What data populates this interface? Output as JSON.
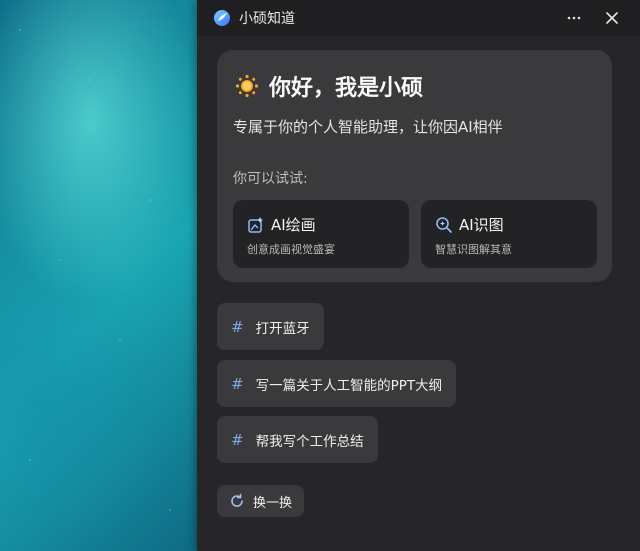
{
  "window": {
    "title": "小硕知道",
    "more_icon": "more-horizontal-icon",
    "close_icon": "close-icon"
  },
  "welcome": {
    "emoji_icon": "sun-icon",
    "title": "你好，我是小硕",
    "subtitle": "专属于你的个人智能助理，让你因AI相伴",
    "try_label": "你可以试试:"
  },
  "features": [
    {
      "icon": "ai-paint-icon",
      "title": "AI绘画",
      "desc": "创意成画视觉盛宴"
    },
    {
      "icon": "ai-image-search-icon",
      "title": "AI识图",
      "desc": "智慧识图解其意"
    }
  ],
  "suggestions": [
    {
      "hash": "#",
      "text": "打开蓝牙"
    },
    {
      "hash": "#",
      "text": "写一篇关于人工智能的PPT大纲"
    },
    {
      "hash": "#",
      "text": "帮我写个工作总结"
    }
  ],
  "refresh": {
    "label": "换一换",
    "icon": "refresh-icon"
  },
  "colors": {
    "panel": "#262628",
    "card": "#3a3a3c",
    "accent": "#7fa8e6"
  }
}
